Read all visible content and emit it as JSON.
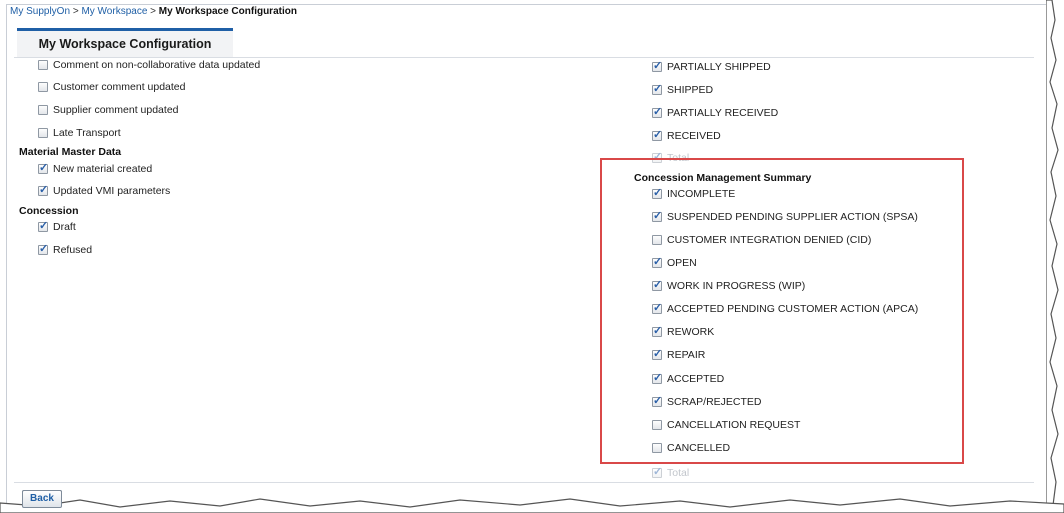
{
  "breadcrumb": {
    "items": [
      "My SupplyOn",
      "My Workspace"
    ],
    "separator": ">",
    "current": "My Workspace Configuration"
  },
  "tab": {
    "label": "My Workspace Configuration"
  },
  "left_column": {
    "top_items": [
      {
        "label": "Comment on non-collaborative data updated",
        "checked": false
      },
      {
        "label": "Customer comment updated",
        "checked": false
      },
      {
        "label": "Supplier comment updated",
        "checked": false
      },
      {
        "label": "Late Transport",
        "checked": false
      }
    ],
    "material_master_data": {
      "heading": "Material Master Data",
      "items": [
        {
          "label": "New material created",
          "checked": true
        },
        {
          "label": "Updated VMI parameters",
          "checked": true
        }
      ]
    },
    "concession": {
      "heading": "Concession",
      "items": [
        {
          "label": "Draft",
          "checked": true
        },
        {
          "label": "Refused",
          "checked": true
        }
      ]
    }
  },
  "right_column": {
    "top_items": [
      {
        "label": "PARTIALLY SHIPPED",
        "checked": true
      },
      {
        "label": "SHIPPED",
        "checked": true
      },
      {
        "label": "PARTIALLY RECEIVED",
        "checked": true
      },
      {
        "label": "RECEIVED",
        "checked": true
      },
      {
        "label": "Total",
        "checked": true,
        "disabled": true
      }
    ],
    "concession_summary": {
      "heading": "Concession Management Summary",
      "items": [
        {
          "label": "INCOMPLETE",
          "checked": true
        },
        {
          "label": "SUSPENDED PENDING SUPPLIER ACTION (SPSA)",
          "checked": true
        },
        {
          "label": "CUSTOMER INTEGRATION DENIED (CID)",
          "checked": false
        },
        {
          "label": "OPEN",
          "checked": true
        },
        {
          "label": "WORK IN PROGRESS (WIP)",
          "checked": true
        },
        {
          "label": "ACCEPTED PENDING CUSTOMER ACTION (APCA)",
          "checked": true
        },
        {
          "label": "REWORK",
          "checked": true
        },
        {
          "label": "REPAIR",
          "checked": true
        },
        {
          "label": "ACCEPTED",
          "checked": true
        },
        {
          "label": "SCRAP/REJECTED",
          "checked": true
        },
        {
          "label": "CANCELLATION REQUEST",
          "checked": false
        },
        {
          "label": "CANCELLED",
          "checked": false
        }
      ],
      "total": {
        "label": "Total",
        "checked": true,
        "disabled": true
      }
    }
  },
  "footer": {
    "back_label": "Back"
  },
  "colors": {
    "link": "#1f5fa6",
    "highlight_border": "#d94848",
    "tab_accent": "#1f5fa6"
  }
}
